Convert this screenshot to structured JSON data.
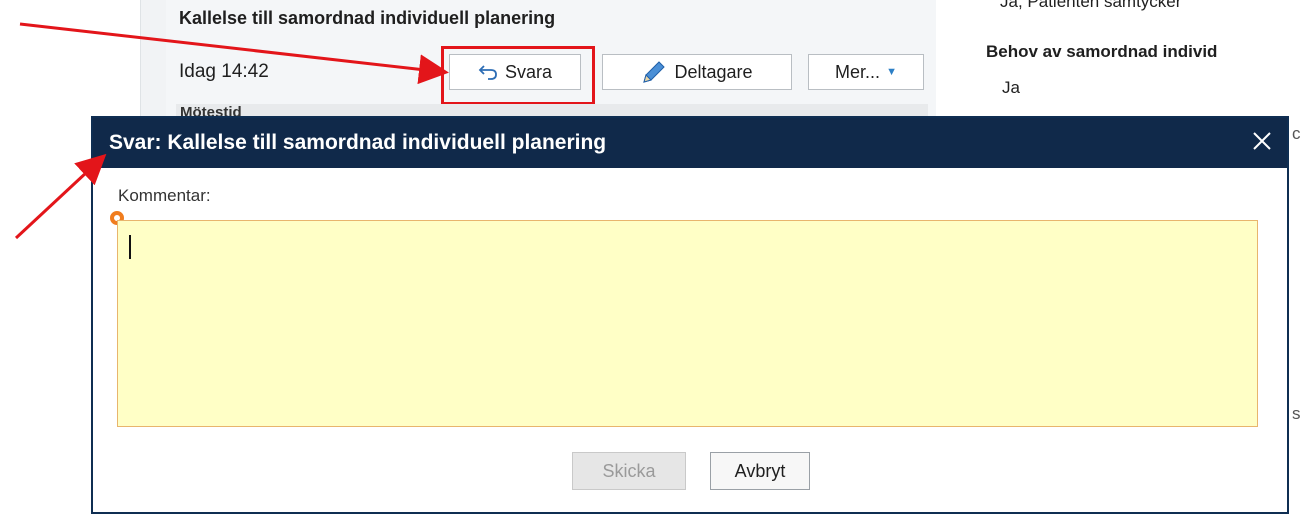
{
  "message": {
    "title": "Kallelse till samordnad individuell planering",
    "time": "Idag 14:42",
    "reply_label": "Svara",
    "participants_label": "Deltagare",
    "more_label": "Mer...",
    "peek_text": "Mötestid"
  },
  "right_panel": {
    "consent_text": "Ja, Patienten samtycker",
    "need_heading": "Behov av samordnad individ",
    "need_value": "Ja",
    "edge_chars": [
      "c",
      "s"
    ]
  },
  "dialog": {
    "title": "Svar: Kallelse till samordnad individuell planering",
    "comment_label": "Kommentar:",
    "comment_value": "",
    "send_label": "Skicka",
    "cancel_label": "Avbryt"
  },
  "icons": {
    "reply": "reply-arrow-icon",
    "pencil": "pencil-icon",
    "caret": "chevron-down-icon",
    "close": "close-icon",
    "required": "required-marker-icon"
  },
  "colors": {
    "dialog_header": "#10294a",
    "comment_bg": "#ffffc6",
    "annotation": "#e3151a",
    "required_marker": "#f07d1e"
  }
}
